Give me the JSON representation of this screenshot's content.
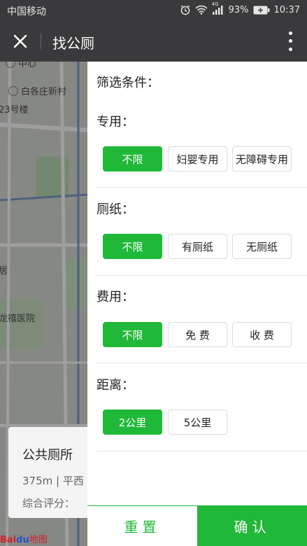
{
  "status_bar": {
    "carrier": "中国移动",
    "network": "4G",
    "battery": "93%",
    "time": "10:37"
  },
  "header": {
    "title": "找公厕",
    "close_icon": "close-icon",
    "more_icon": "more-vertical-icon"
  },
  "map": {
    "labels": {
      "top": "中心",
      "village": "白各庄新村",
      "building": "23号楼",
      "left": "居",
      "hospital": "龙禧医院"
    },
    "card": {
      "title": "公共厕所",
      "distance": "375m | 平西",
      "rating": "综合评分："
    },
    "logo": {
      "part1": "Bai",
      "part2": "du",
      "part3": "地图"
    }
  },
  "filter": {
    "heading": "筛选条件：",
    "sections": [
      {
        "label": "专用：",
        "options": [
          "不限",
          "妇婴专用",
          "无障碍专用"
        ],
        "selected": 0
      },
      {
        "label": "厕纸：",
        "options": [
          "不限",
          "有厕纸",
          "无厕纸"
        ],
        "selected": 0
      },
      {
        "label": "费用：",
        "options": [
          "不限",
          "免 费",
          "收 费"
        ],
        "selected": 0
      },
      {
        "label": "距离：",
        "options": [
          "2公里",
          "5公里"
        ],
        "selected": 0
      }
    ],
    "reset_label": "重置",
    "confirm_label": "确认"
  },
  "colors": {
    "accent": "#20b838",
    "titlebar": "#3a3a3c"
  }
}
